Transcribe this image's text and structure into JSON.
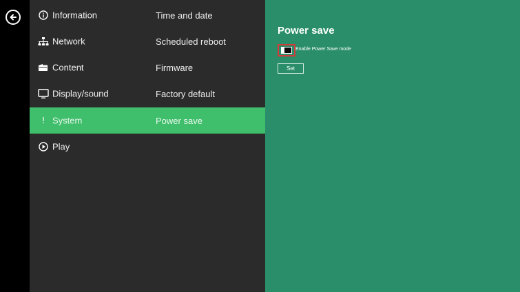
{
  "menu": {
    "rows": [
      {
        "category": "Information",
        "category_icon": "info-circle-icon",
        "sub": "Time and date"
      },
      {
        "category": "Network",
        "category_icon": "network-icon",
        "sub": "Scheduled reboot"
      },
      {
        "category": "Content",
        "category_icon": "folder-icon",
        "sub": "Firmware"
      },
      {
        "category": "Display/sound",
        "category_icon": "monitor-icon",
        "sub": "Factory default"
      },
      {
        "category": "System",
        "category_icon": "system-icon",
        "sub": "Power save",
        "active": true
      },
      {
        "category": "Play",
        "category_icon": "play-circle-icon"
      }
    ]
  },
  "back_icon": "back-arrow-circle-icon",
  "panel": {
    "title": "Power save",
    "option_label": "Enable Power Save mode",
    "option_enabled": false,
    "set_label": "Set"
  },
  "colors": {
    "menu_bg": "#2b2b2b",
    "active_row": "#3fbe6b",
    "panel_bg": "#2a8e6a",
    "highlight": "#d33a3a"
  }
}
